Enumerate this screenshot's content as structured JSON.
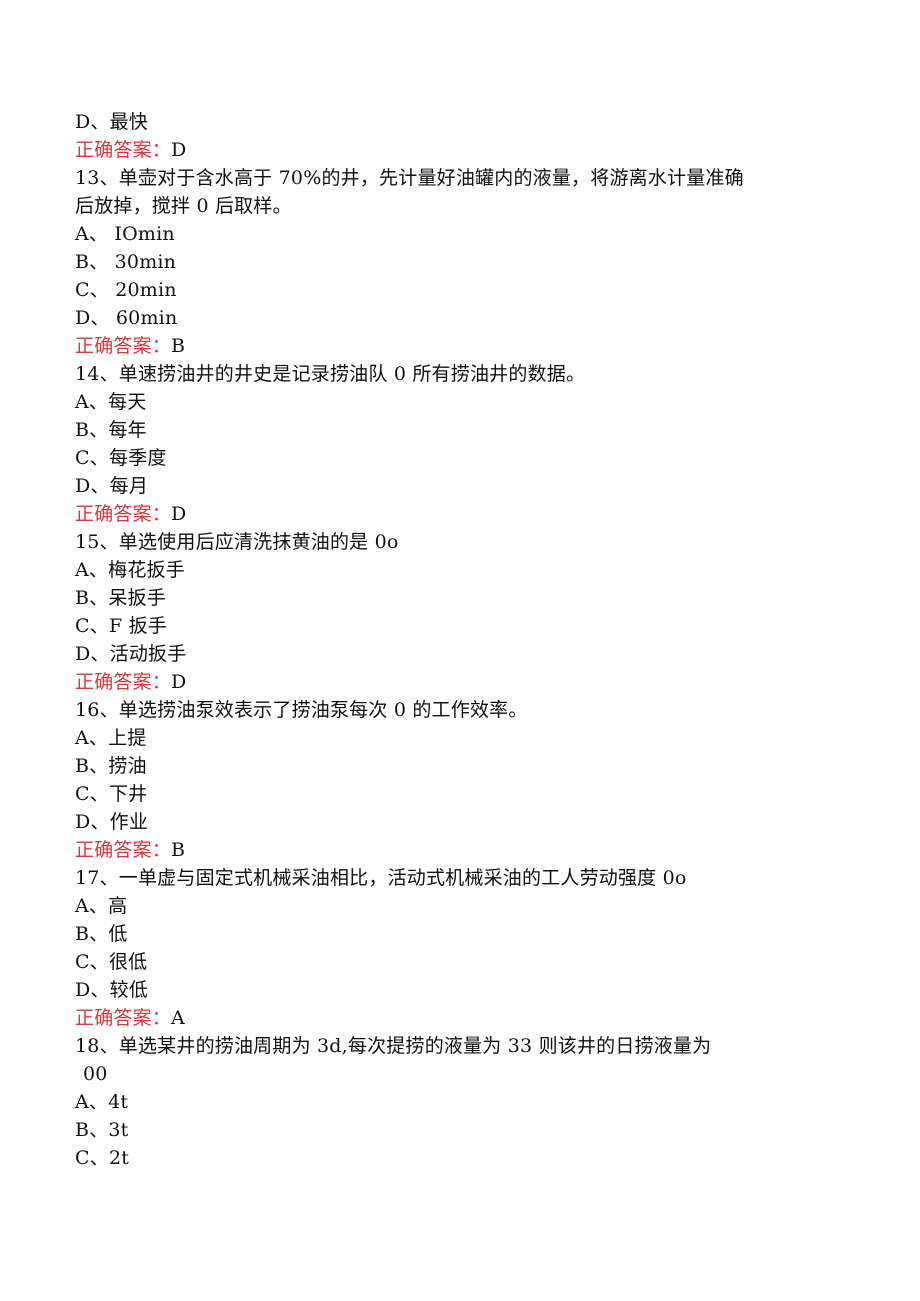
{
  "answer_label": "正确答案：",
  "colors": {
    "answer_label": "#d9383a",
    "text": "#111111"
  },
  "prev_tail": {
    "options": [
      {
        "key": "D、",
        "text": "最快"
      }
    ],
    "answer": "D"
  },
  "questions": [
    {
      "number": "13、",
      "stem_line1": "单壶对于含水高于 70%的井，先计量好油罐内的液量，将游离水计量准确",
      "stem_line2": "后放掉，搅拌 0 后取样。",
      "options": [
        {
          "key": "A、",
          "text": " IOmin"
        },
        {
          "key": "B、",
          "text": " 30min"
        },
        {
          "key": "C、",
          "text": " 20min"
        },
        {
          "key": "D、",
          "text": " 60min"
        }
      ],
      "answer": "B"
    },
    {
      "number": "14、",
      "stem_line1": "单速捞油井的井史是记录捞油队 0 所有捞油井的数据。",
      "options": [
        {
          "key": "A、",
          "text": "每天"
        },
        {
          "key": "B、",
          "text": "每年"
        },
        {
          "key": "C、",
          "text": "每季度"
        },
        {
          "key": "D、",
          "text": "每月"
        }
      ],
      "answer": "D"
    },
    {
      "number": "15、",
      "stem_line1": "单选使用后应清洗抹黄油的是 0o",
      "options": [
        {
          "key": "A、",
          "text": "梅花扳手"
        },
        {
          "key": "B、",
          "text": "呆扳手"
        },
        {
          "key": "C、",
          "text": "F 扳手"
        },
        {
          "key": "D、",
          "text": "活动扳手"
        }
      ],
      "answer": "D"
    },
    {
      "number": "16、",
      "stem_line1": "单选捞油泵效表示了捞油泵每次 0 的工作效率。",
      "options": [
        {
          "key": "A、",
          "text": "上提"
        },
        {
          "key": "B、",
          "text": "捞油"
        },
        {
          "key": "C、",
          "text": "下井"
        },
        {
          "key": "D、",
          "text": "作业"
        }
      ],
      "answer": "B"
    },
    {
      "number": "17、",
      "stem_line1": "一单虚与固定式机械采油相比，活动式机械采油的工人劳动强度 0o",
      "options": [
        {
          "key": "A、",
          "text": "高"
        },
        {
          "key": "B、",
          "text": "低"
        },
        {
          "key": "C、",
          "text": "很低"
        },
        {
          "key": "D、",
          "text": "较低"
        }
      ],
      "answer": "A"
    },
    {
      "number": "18、",
      "stem_line1": "单选某井的捞油周期为 3d,每次提捞的液量为 33 则该井的日捞液量为",
      "stem_line2": "00",
      "options": [
        {
          "key": "A、",
          "text": "4t"
        },
        {
          "key": "B、",
          "text": "3t"
        },
        {
          "key": "C、",
          "text": "2t"
        }
      ]
    }
  ]
}
